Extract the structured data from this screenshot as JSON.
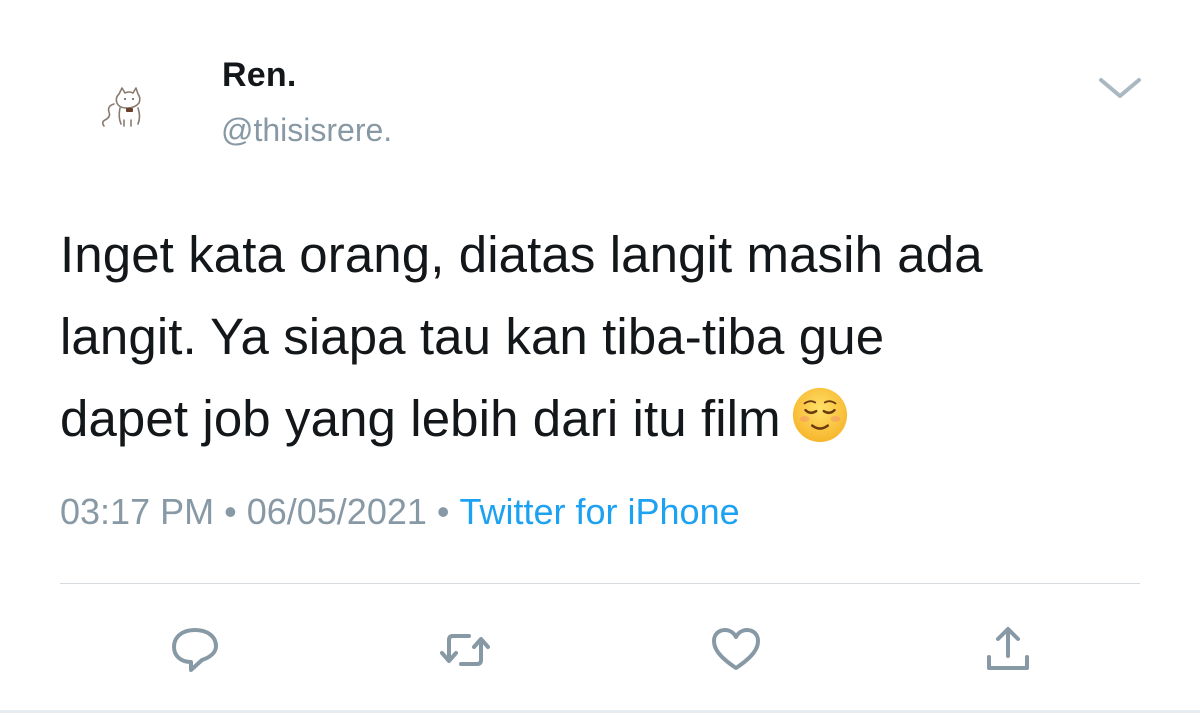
{
  "tweet": {
    "display_name": "Ren.",
    "handle": "@thisisrere.",
    "text_lines": [
      "Inget kata orang, diatas langit masih ada",
      "langit. Ya siapa tau kan tiba-tiba gue",
      "dapet job yang lebih dari itu film"
    ],
    "emoji": "relieved-face",
    "time": "03:17 PM",
    "separator": "•",
    "date": "06/05/2021",
    "source": "Twitter for iPhone"
  },
  "icons": {
    "menu": "chevron-down-icon",
    "reply": "reply-icon",
    "retweet": "retweet-icon",
    "like": "heart-icon",
    "share": "share-icon"
  },
  "colors": {
    "text": "#14171a",
    "secondary": "#8899a6",
    "link": "#1da1f2",
    "divider": "#d6dbdf"
  }
}
